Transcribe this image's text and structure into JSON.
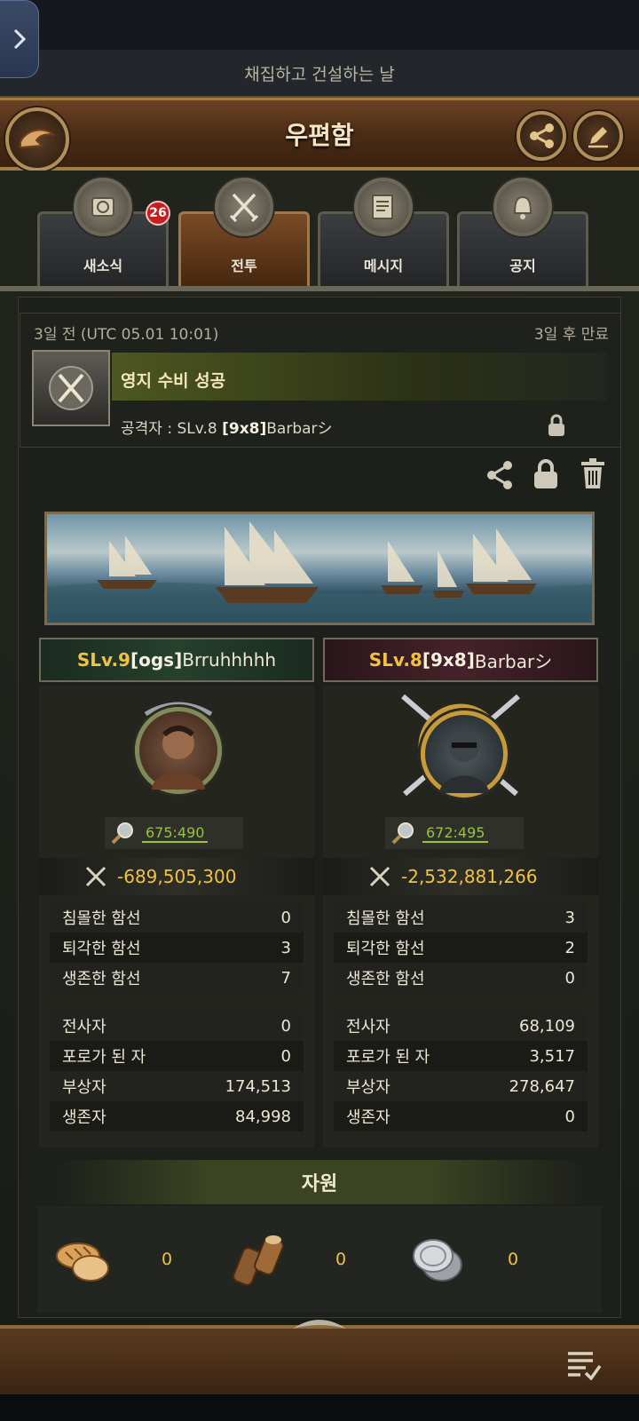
{
  "header": {
    "subtitle": "채집하고 건설하는 날",
    "title": "우편함"
  },
  "tabs": [
    {
      "label": "새소식",
      "badge": "26"
    },
    {
      "label": "전투"
    },
    {
      "label": "메시지"
    },
    {
      "label": "공지"
    }
  ],
  "mail": {
    "time": "3일 전 (UTC 05.01 10:01)",
    "expiry": "3일 후 만료",
    "title": "영지 수비 성공",
    "attacker_label": "공격자 : SLv.8 ",
    "attacker_alliance": "[9x8]",
    "attacker_name": "Barbarシ"
  },
  "left": {
    "level": "SLv.9 ",
    "alliance": "[ogs]",
    "name": "Brruhhhhh",
    "coords": "675:490",
    "power": "-689,505,300",
    "ships": [
      {
        "label": "침몰한 함선",
        "value": "0"
      },
      {
        "label": "퇴각한 함선",
        "value": "3"
      },
      {
        "label": "생존한 함선",
        "value": "7"
      }
    ],
    "troops": [
      {
        "label": "전사자",
        "value": "0"
      },
      {
        "label": "포로가 된 자",
        "value": "0"
      },
      {
        "label": "부상자",
        "value": "174,513"
      },
      {
        "label": "생존자",
        "value": "84,998"
      }
    ]
  },
  "right": {
    "level": "SLv.8 ",
    "alliance": "[9x8]",
    "name": "Barbarシ",
    "coords": "672:495",
    "power": "-2,532,881,266",
    "ships": [
      {
        "label": "침몰한 함선",
        "value": "3"
      },
      {
        "label": "퇴각한 함선",
        "value": "2"
      },
      {
        "label": "생존한 함선",
        "value": "0"
      }
    ],
    "troops": [
      {
        "label": "전사자",
        "value": "68,109"
      },
      {
        "label": "포로가 된 자",
        "value": "3,517"
      },
      {
        "label": "부상자",
        "value": "278,647"
      },
      {
        "label": "생존자",
        "value": "0"
      }
    ]
  },
  "resources": {
    "title": "자원",
    "items": [
      {
        "icon": "bread-icon",
        "value": "0"
      },
      {
        "icon": "wood-icon",
        "value": "0"
      },
      {
        "icon": "silver-coin-icon",
        "value": "0"
      }
    ]
  },
  "colors": {
    "accent_gold": "#f2c13d",
    "coord_green": "#98c43a",
    "badge_red": "#c61d1d"
  }
}
